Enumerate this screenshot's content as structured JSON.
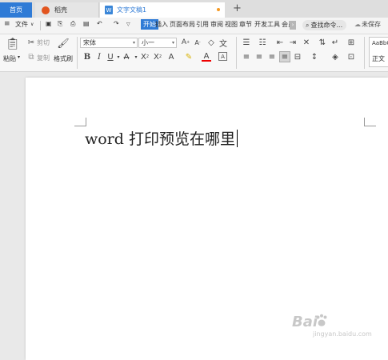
{
  "tabs": {
    "home": "首页",
    "daoke": "稻壳",
    "doc": "文字文稿1",
    "doc_icon": "W",
    "new_tab": "+"
  },
  "menu": {
    "file": "文件",
    "items": [
      "开始",
      "插入",
      "页面布局",
      "引用",
      "审阅",
      "视图",
      "章节",
      "开发工具",
      "会员"
    ],
    "search": "查找命令...",
    "unsaved": "未保存"
  },
  "ribbon": {
    "paste": "粘贴",
    "cut": "剪切",
    "copy": "复制",
    "format_painter": "格式刷",
    "font_name": "宋体",
    "font_size": "小一",
    "style_preview": "AaBbC",
    "style_name": "正文"
  },
  "document": {
    "text": "word 打印预览在哪里"
  },
  "watermark": {
    "brand": "Bai",
    "sub": "jingyan.baidu.com"
  },
  "colors": {
    "accent": "#2f7bd6",
    "daoke": "#e2551f",
    "dot": "#f59a23"
  }
}
